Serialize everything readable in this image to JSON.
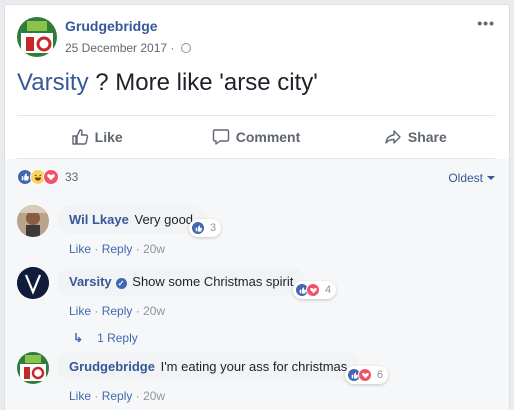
{
  "post": {
    "author": "Grudgebridge",
    "date": "25 December 2017",
    "date_sep": "·",
    "text_link": "Varsity",
    "text_rest": " ? More like 'arse city'",
    "actions": {
      "like": "Like",
      "comment": "Comment",
      "share": "Share"
    },
    "reaction_count": "33",
    "order_label": "Oldest"
  },
  "comments": [
    {
      "name": "Wil Lkaye",
      "text": "Very good",
      "reactions": "3",
      "like": "Like",
      "reply": "Reply",
      "time": "20w"
    },
    {
      "name": "Varsity",
      "text": "Show some Christmas spirit",
      "reactions": "4",
      "like": "Like",
      "reply": "Reply",
      "time": "20w",
      "replies": "1 Reply"
    },
    {
      "name": "Grudgebridge",
      "text": "I'm eating your ass for christmas",
      "reactions": "6",
      "like": "Like",
      "reply": "Reply",
      "time": "20w"
    }
  ],
  "meta_sep": "·",
  "colors": {
    "link": "#365899",
    "like_blue": "#4267b2",
    "love_red": "#f25268",
    "haha_yellow": "#fcd45a"
  },
  "icons": {
    "like": "thumbs-up-icon",
    "comment": "speech-bubble-icon",
    "share": "share-arrow-icon",
    "more": "ellipsis-icon"
  }
}
